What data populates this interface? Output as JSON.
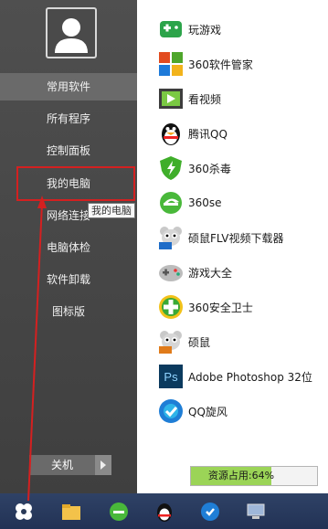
{
  "sidebar": {
    "items": [
      {
        "label": "常用软件"
      },
      {
        "label": "所有程序"
      },
      {
        "label": "控制面板"
      },
      {
        "label": "我的电脑"
      },
      {
        "label": "网络连接"
      },
      {
        "label": "电脑体检"
      },
      {
        "label": "软件卸载"
      },
      {
        "label": "图标版"
      }
    ],
    "tooltip": "我的电脑",
    "shutdown_label": "关机"
  },
  "apps": [
    {
      "label": "玩游戏",
      "icon": "gamepad-icon"
    },
    {
      "label": "360软件管家",
      "icon": "software-manager-icon"
    },
    {
      "label": "看视频",
      "icon": "video-icon"
    },
    {
      "label": "腾讯QQ",
      "icon": "qq-penguin-icon"
    },
    {
      "label": "360杀毒",
      "icon": "antivirus-shield-icon"
    },
    {
      "label": "360se",
      "icon": "browser-360se-icon"
    },
    {
      "label": "硕鼠FLV视频下载器",
      "icon": "mouse-downloader-icon"
    },
    {
      "label": "游戏大全",
      "icon": "game-collection-icon"
    },
    {
      "label": "360安全卫士",
      "icon": "security-guard-icon"
    },
    {
      "label": "硕鼠",
      "icon": "mouse-icon"
    },
    {
      "label": "Adobe Photoshop 32位",
      "icon": "photoshop-icon"
    },
    {
      "label": "QQ旋风",
      "icon": "qq-whirlwind-icon"
    }
  ],
  "resource": {
    "label": "资源占用:64%",
    "percent": 64
  },
  "taskbar": {
    "icons": [
      "start-icon",
      "file-explorer-icon",
      "browser-360se-icon",
      "qq-penguin-icon",
      "qq-whirlwind-icon",
      "computer-icon"
    ]
  },
  "colors": {
    "highlight": "#d42020",
    "accent": "#9bd457"
  }
}
